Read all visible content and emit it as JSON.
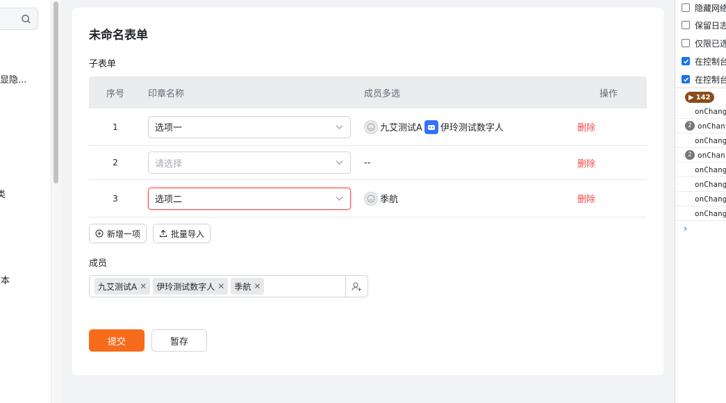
{
  "sidebar": {
    "items": [
      "显隐...",
      "类",
      "文本"
    ]
  },
  "form": {
    "title": "未命名表单",
    "subform_label": "子表单",
    "columns": {
      "seq": "序号",
      "seal": "印章名称",
      "members": "成员多选",
      "action": "操作"
    },
    "rows": [
      {
        "seq": "1",
        "seal": "选项一",
        "placeholder": "",
        "members": [
          "九艾测试A",
          "伊玲测试数字人"
        ],
        "empty": "",
        "action": "删除"
      },
      {
        "seq": "2",
        "seal": "",
        "placeholder": "请选择",
        "members": [],
        "empty": "--",
        "action": "删除"
      },
      {
        "seq": "3",
        "seal": "选项二",
        "placeholder": "",
        "members": [
          "季航"
        ],
        "empty": "",
        "action": "删除"
      }
    ],
    "add_button": "新增一项",
    "import_button": "批量导入",
    "members_label": "成员",
    "member_tags": [
      "九艾测试A",
      "伊玲测试数字人",
      "季航"
    ],
    "submit_button": "提交",
    "save_button": "暂存"
  },
  "devtools": {
    "options": [
      {
        "label": "隐藏网络",
        "checked": false
      },
      {
        "label": "保留日志",
        "checked": false
      },
      {
        "label": "仅限已选",
        "checked": false
      },
      {
        "label": "在控制台",
        "checked": true
      },
      {
        "label": "在控制台",
        "checked": true
      }
    ],
    "message_count": "142",
    "logs": [
      {
        "count": "",
        "text": "onChang"
      },
      {
        "count": "2",
        "text": "onChan"
      },
      {
        "count": "",
        "text": "onChang"
      },
      {
        "count": "2",
        "text": "onChan"
      },
      {
        "count": "",
        "text": "onChang"
      },
      {
        "count": "",
        "text": "onChang"
      },
      {
        "count": "",
        "text": "onChang"
      },
      {
        "count": "",
        "text": "onChang"
      }
    ],
    "caret": "›"
  },
  "colors": {
    "primary": "#f76b1c",
    "danger": "#f54a45",
    "header_bg": "#ebecee"
  }
}
